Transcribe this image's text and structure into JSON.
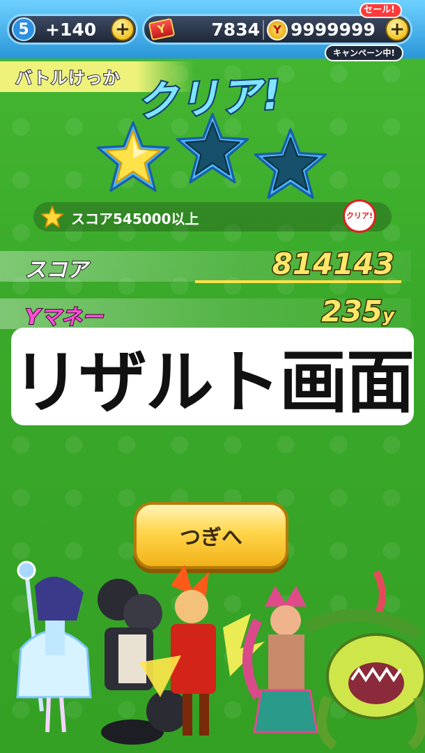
{
  "top_bar": {
    "level": "5",
    "stamina": "+140",
    "ticket_count": "7834",
    "money_count": "9999999",
    "sale_tag": "セール!",
    "campaign_tag": "キャンペーン中!"
  },
  "header": {
    "battle_label": "バトルけっか",
    "clear_title": "クリア!"
  },
  "stars": {
    "earned": 1,
    "total": 3
  },
  "condition": {
    "text": "スコア545000以上",
    "badge": "クリア!"
  },
  "results": {
    "score_label": "スコア",
    "score_value": "814143",
    "money_label": "Yマネー",
    "money_value": "235",
    "money_unit": "y"
  },
  "overlay_caption": "リザルト画面",
  "next_button": "つぎへ",
  "colors": {
    "background": "#3aa92a",
    "topbar": "#2a96d8",
    "score_value": "#ffe76a",
    "money_label": "#ff4fd8",
    "button": "#ffd54a"
  }
}
